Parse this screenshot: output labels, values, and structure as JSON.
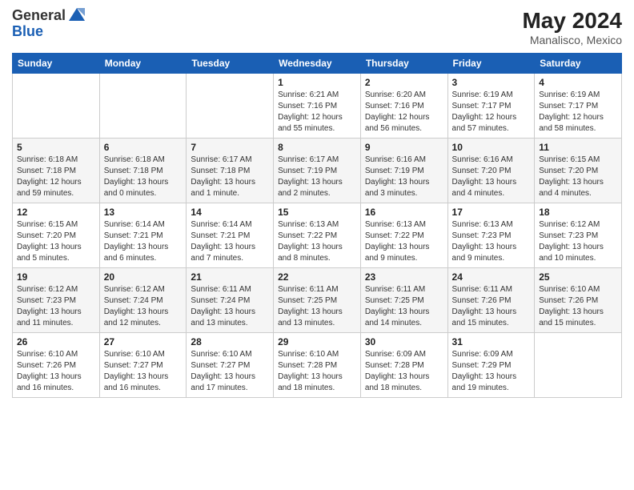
{
  "header": {
    "logo_line1": "General",
    "logo_line2": "Blue",
    "month_year": "May 2024",
    "location": "Manalisco, Mexico"
  },
  "days_of_week": [
    "Sunday",
    "Monday",
    "Tuesday",
    "Wednesday",
    "Thursday",
    "Friday",
    "Saturday"
  ],
  "weeks": [
    [
      {
        "day": "",
        "sunrise": "",
        "sunset": "",
        "daylight": ""
      },
      {
        "day": "",
        "sunrise": "",
        "sunset": "",
        "daylight": ""
      },
      {
        "day": "",
        "sunrise": "",
        "sunset": "",
        "daylight": ""
      },
      {
        "day": "1",
        "sunrise": "6:21 AM",
        "sunset": "7:16 PM",
        "daylight": "12 hours and 55 minutes."
      },
      {
        "day": "2",
        "sunrise": "6:20 AM",
        "sunset": "7:16 PM",
        "daylight": "12 hours and 56 minutes."
      },
      {
        "day": "3",
        "sunrise": "6:19 AM",
        "sunset": "7:17 PM",
        "daylight": "12 hours and 57 minutes."
      },
      {
        "day": "4",
        "sunrise": "6:19 AM",
        "sunset": "7:17 PM",
        "daylight": "12 hours and 58 minutes."
      }
    ],
    [
      {
        "day": "5",
        "sunrise": "6:18 AM",
        "sunset": "7:18 PM",
        "daylight": "12 hours and 59 minutes."
      },
      {
        "day": "6",
        "sunrise": "6:18 AM",
        "sunset": "7:18 PM",
        "daylight": "13 hours and 0 minutes."
      },
      {
        "day": "7",
        "sunrise": "6:17 AM",
        "sunset": "7:18 PM",
        "daylight": "13 hours and 1 minute."
      },
      {
        "day": "8",
        "sunrise": "6:17 AM",
        "sunset": "7:19 PM",
        "daylight": "13 hours and 2 minutes."
      },
      {
        "day": "9",
        "sunrise": "6:16 AM",
        "sunset": "7:19 PM",
        "daylight": "13 hours and 3 minutes."
      },
      {
        "day": "10",
        "sunrise": "6:16 AM",
        "sunset": "7:20 PM",
        "daylight": "13 hours and 4 minutes."
      },
      {
        "day": "11",
        "sunrise": "6:15 AM",
        "sunset": "7:20 PM",
        "daylight": "13 hours and 4 minutes."
      }
    ],
    [
      {
        "day": "12",
        "sunrise": "6:15 AM",
        "sunset": "7:20 PM",
        "daylight": "13 hours and 5 minutes."
      },
      {
        "day": "13",
        "sunrise": "6:14 AM",
        "sunset": "7:21 PM",
        "daylight": "13 hours and 6 minutes."
      },
      {
        "day": "14",
        "sunrise": "6:14 AM",
        "sunset": "7:21 PM",
        "daylight": "13 hours and 7 minutes."
      },
      {
        "day": "15",
        "sunrise": "6:13 AM",
        "sunset": "7:22 PM",
        "daylight": "13 hours and 8 minutes."
      },
      {
        "day": "16",
        "sunrise": "6:13 AM",
        "sunset": "7:22 PM",
        "daylight": "13 hours and 9 minutes."
      },
      {
        "day": "17",
        "sunrise": "6:13 AM",
        "sunset": "7:23 PM",
        "daylight": "13 hours and 9 minutes."
      },
      {
        "day": "18",
        "sunrise": "6:12 AM",
        "sunset": "7:23 PM",
        "daylight": "13 hours and 10 minutes."
      }
    ],
    [
      {
        "day": "19",
        "sunrise": "6:12 AM",
        "sunset": "7:23 PM",
        "daylight": "13 hours and 11 minutes."
      },
      {
        "day": "20",
        "sunrise": "6:12 AM",
        "sunset": "7:24 PM",
        "daylight": "13 hours and 12 minutes."
      },
      {
        "day": "21",
        "sunrise": "6:11 AM",
        "sunset": "7:24 PM",
        "daylight": "13 hours and 13 minutes."
      },
      {
        "day": "22",
        "sunrise": "6:11 AM",
        "sunset": "7:25 PM",
        "daylight": "13 hours and 13 minutes."
      },
      {
        "day": "23",
        "sunrise": "6:11 AM",
        "sunset": "7:25 PM",
        "daylight": "13 hours and 14 minutes."
      },
      {
        "day": "24",
        "sunrise": "6:11 AM",
        "sunset": "7:26 PM",
        "daylight": "13 hours and 15 minutes."
      },
      {
        "day": "25",
        "sunrise": "6:10 AM",
        "sunset": "7:26 PM",
        "daylight": "13 hours and 15 minutes."
      }
    ],
    [
      {
        "day": "26",
        "sunrise": "6:10 AM",
        "sunset": "7:26 PM",
        "daylight": "13 hours and 16 minutes."
      },
      {
        "day": "27",
        "sunrise": "6:10 AM",
        "sunset": "7:27 PM",
        "daylight": "13 hours and 16 minutes."
      },
      {
        "day": "28",
        "sunrise": "6:10 AM",
        "sunset": "7:27 PM",
        "daylight": "13 hours and 17 minutes."
      },
      {
        "day": "29",
        "sunrise": "6:10 AM",
        "sunset": "7:28 PM",
        "daylight": "13 hours and 18 minutes."
      },
      {
        "day": "30",
        "sunrise": "6:09 AM",
        "sunset": "7:28 PM",
        "daylight": "13 hours and 18 minutes."
      },
      {
        "day": "31",
        "sunrise": "6:09 AM",
        "sunset": "7:29 PM",
        "daylight": "13 hours and 19 minutes."
      },
      {
        "day": "",
        "sunrise": "",
        "sunset": "",
        "daylight": ""
      }
    ]
  ]
}
